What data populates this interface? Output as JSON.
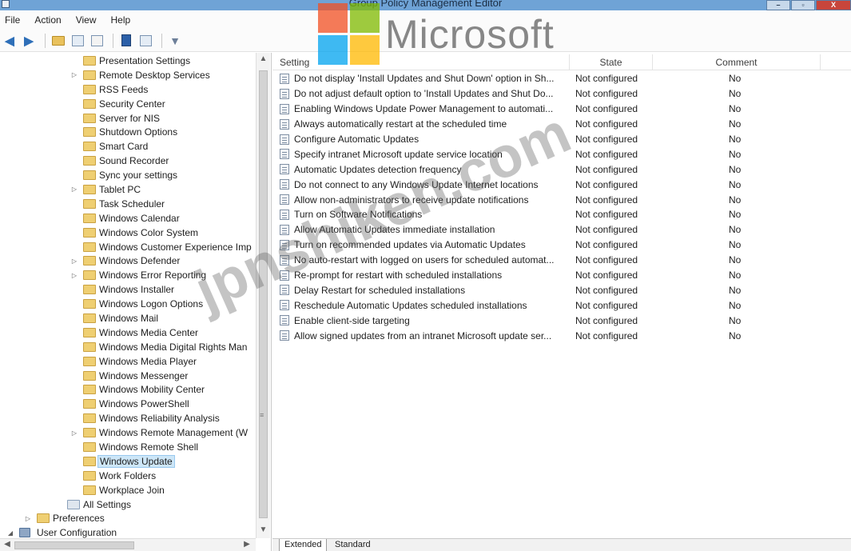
{
  "window": {
    "title": "Group Policy Management Editor",
    "buttons": [
      "–",
      "▫",
      "X"
    ]
  },
  "menu": [
    "File",
    "Action",
    "View",
    "Help"
  ],
  "toolbar": {
    "icons": [
      "back-icon",
      "forward-icon",
      "up-folder-icon",
      "show-hide-tree-icon",
      "export-list-icon",
      "help-icon",
      "properties-icon",
      "filter-icon"
    ]
  },
  "watermark": {
    "brand": "Microsoft",
    "overlay": "jpnshiken.com"
  },
  "tree": {
    "items": [
      {
        "label": "Presentation Settings",
        "expandable": false
      },
      {
        "label": "Remote Desktop Services",
        "expandable": true
      },
      {
        "label": "RSS Feeds",
        "expandable": false
      },
      {
        "label": "Security Center",
        "expandable": false
      },
      {
        "label": "Server for NIS",
        "expandable": false
      },
      {
        "label": "Shutdown Options",
        "expandable": false
      },
      {
        "label": "Smart Card",
        "expandable": false
      },
      {
        "label": "Sound Recorder",
        "expandable": false
      },
      {
        "label": "Sync your settings",
        "expandable": false
      },
      {
        "label": "Tablet PC",
        "expandable": true
      },
      {
        "label": "Task Scheduler",
        "expandable": false
      },
      {
        "label": "Windows Calendar",
        "expandable": false
      },
      {
        "label": "Windows Color System",
        "expandable": false
      },
      {
        "label": "Windows Customer Experience Imp",
        "expandable": false
      },
      {
        "label": "Windows Defender",
        "expandable": true
      },
      {
        "label": "Windows Error Reporting",
        "expandable": true
      },
      {
        "label": "Windows Installer",
        "expandable": false
      },
      {
        "label": "Windows Logon Options",
        "expandable": false
      },
      {
        "label": "Windows Mail",
        "expandable": false
      },
      {
        "label": "Windows Media Center",
        "expandable": false
      },
      {
        "label": "Windows Media Digital Rights Man",
        "expandable": false
      },
      {
        "label": "Windows Media Player",
        "expandable": false
      },
      {
        "label": "Windows Messenger",
        "expandable": false
      },
      {
        "label": "Windows Mobility Center",
        "expandable": false
      },
      {
        "label": "Windows PowerShell",
        "expandable": false
      },
      {
        "label": "Windows Reliability Analysis",
        "expandable": false
      },
      {
        "label": "Windows Remote Management (W",
        "expandable": true
      },
      {
        "label": "Windows Remote Shell",
        "expandable": false
      },
      {
        "label": "Windows Update",
        "expandable": false,
        "selected": true
      },
      {
        "label": "Work Folders",
        "expandable": false
      },
      {
        "label": "Workplace Join",
        "expandable": false
      }
    ],
    "all_settings": "All Settings",
    "preferences": "Preferences",
    "user_configuration": "User Configuration"
  },
  "list": {
    "columns": [
      "Setting",
      "State",
      "Comment"
    ],
    "rows": [
      {
        "setting": "Do not display 'Install Updates and Shut Down' option in Sh...",
        "state": "Not configured",
        "comment": "No"
      },
      {
        "setting": "Do not adjust default option to 'Install Updates and Shut Do...",
        "state": "Not configured",
        "comment": "No"
      },
      {
        "setting": "Enabling Windows Update Power Management to automati...",
        "state": "Not configured",
        "comment": "No"
      },
      {
        "setting": "Always automatically restart at the scheduled time",
        "state": "Not configured",
        "comment": "No"
      },
      {
        "setting": "Configure Automatic Updates",
        "state": "Not configured",
        "comment": "No"
      },
      {
        "setting": "Specify intranet Microsoft update service location",
        "state": "Not configured",
        "comment": "No"
      },
      {
        "setting": "Automatic Updates detection frequency",
        "state": "Not configured",
        "comment": "No"
      },
      {
        "setting": "Do not connect to any Windows Update Internet locations",
        "state": "Not configured",
        "comment": "No"
      },
      {
        "setting": "Allow non-administrators to receive update notifications",
        "state": "Not configured",
        "comment": "No"
      },
      {
        "setting": "Turn on Software Notifications",
        "state": "Not configured",
        "comment": "No"
      },
      {
        "setting": "Allow Automatic Updates immediate installation",
        "state": "Not configured",
        "comment": "No"
      },
      {
        "setting": "Turn on recommended updates via Automatic Updates",
        "state": "Not configured",
        "comment": "No"
      },
      {
        "setting": "No auto-restart with logged on users for scheduled automat...",
        "state": "Not configured",
        "comment": "No"
      },
      {
        "setting": "Re-prompt for restart with scheduled installations",
        "state": "Not configured",
        "comment": "No"
      },
      {
        "setting": "Delay Restart for scheduled installations",
        "state": "Not configured",
        "comment": "No"
      },
      {
        "setting": "Reschedule Automatic Updates scheduled installations",
        "state": "Not configured",
        "comment": "No"
      },
      {
        "setting": "Enable client-side targeting",
        "state": "Not configured",
        "comment": "No"
      },
      {
        "setting": "Allow signed updates from an intranet Microsoft update ser...",
        "state": "Not configured",
        "comment": "No"
      }
    ]
  },
  "tabs": [
    "Extended",
    "Standard"
  ]
}
